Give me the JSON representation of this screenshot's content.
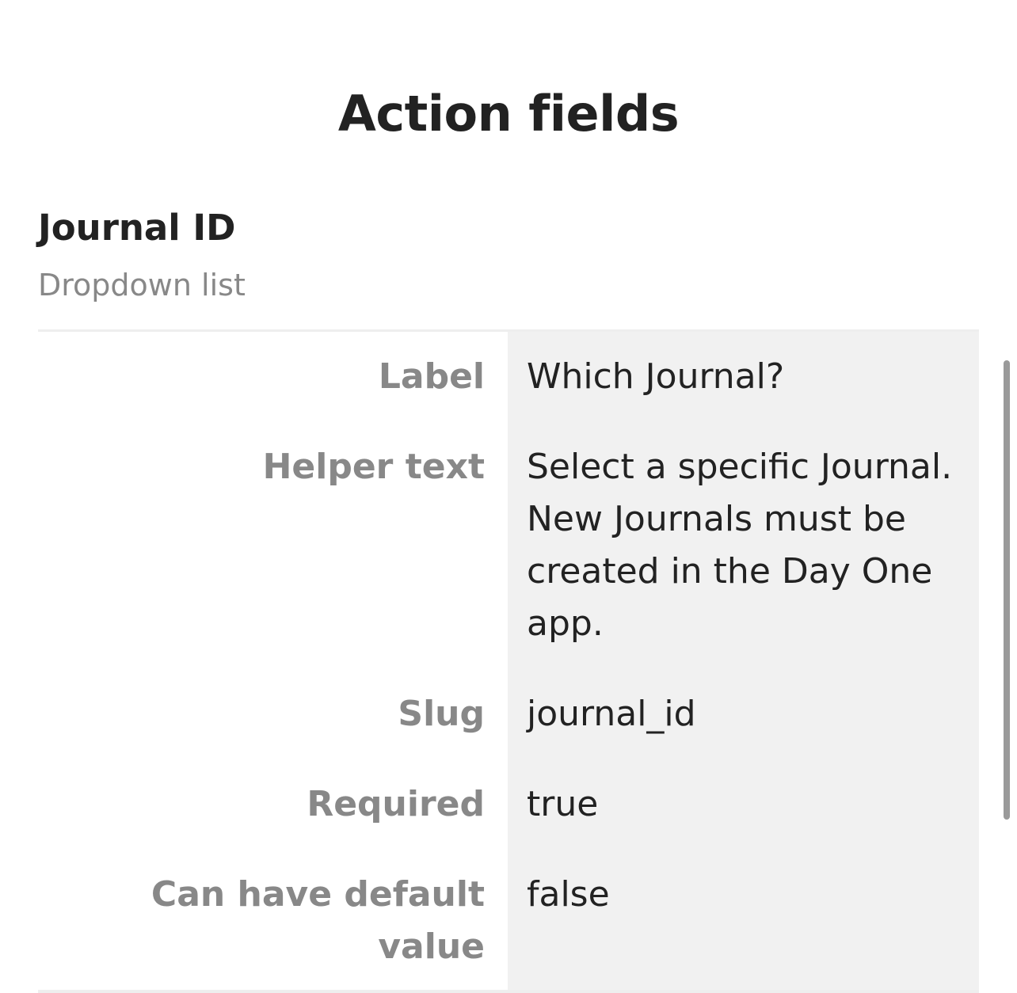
{
  "page": {
    "title": "Action fields"
  },
  "field": {
    "name": "Journal ID",
    "type": "Dropdown list",
    "details": [
      {
        "key": "Label",
        "value": "Which Journal?"
      },
      {
        "key": "Helper text",
        "value": "Select a specific Journal. New Journals must be created in the Day One app."
      },
      {
        "key": "Slug",
        "value": "journal_id"
      },
      {
        "key": "Required",
        "value": "true"
      },
      {
        "key": "Can have default value",
        "value": "false"
      }
    ]
  }
}
